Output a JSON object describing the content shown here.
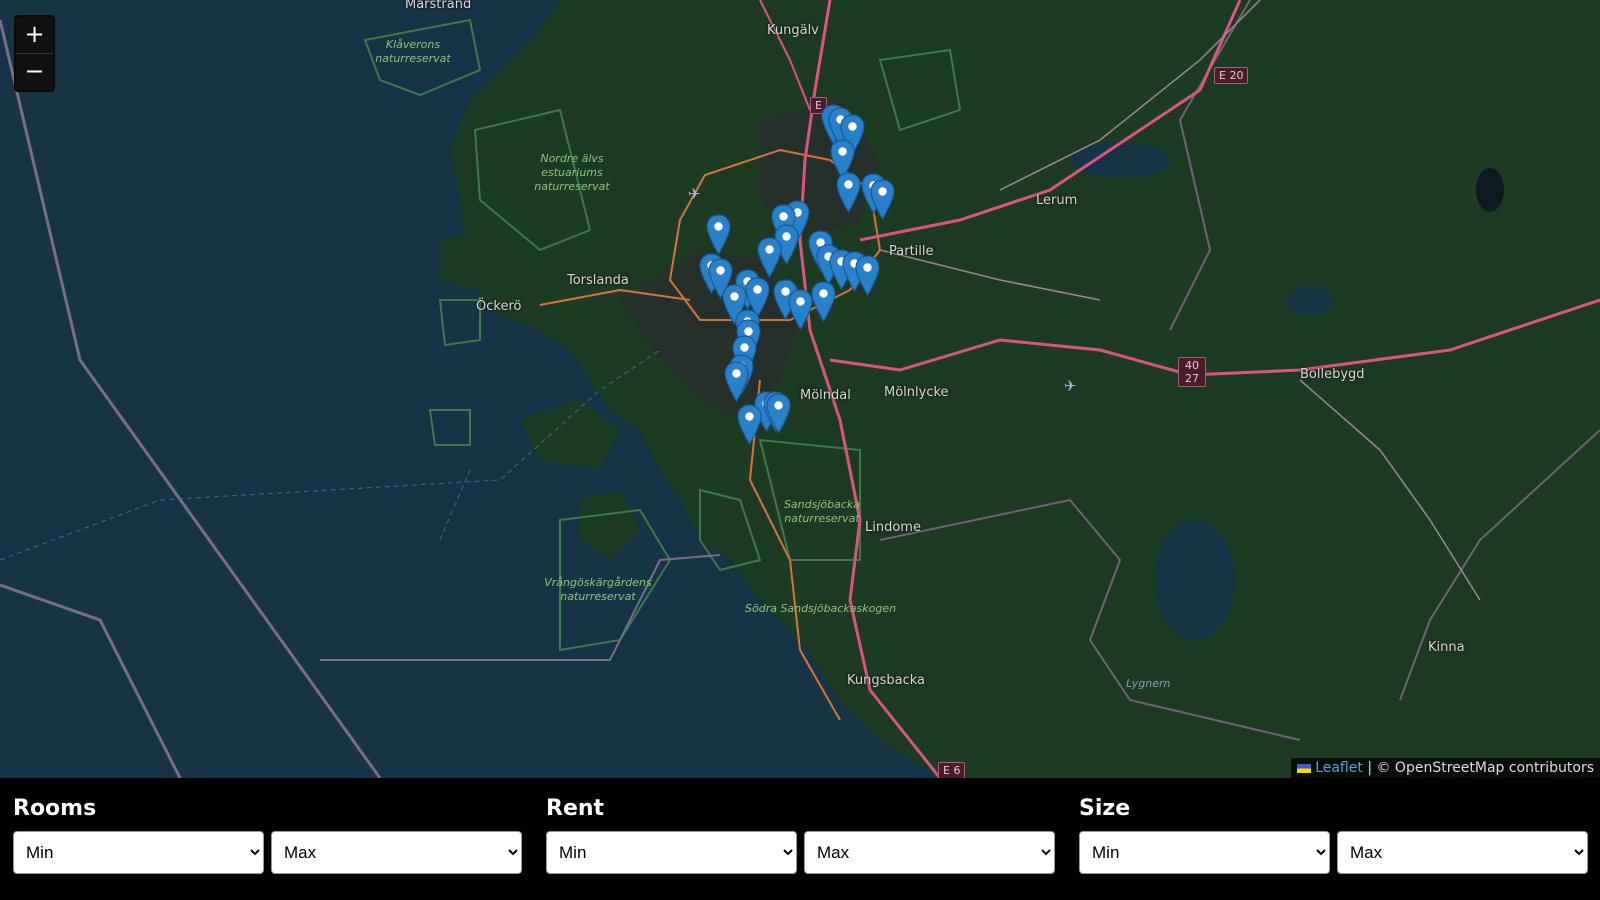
{
  "map": {
    "zoom_in": "+",
    "zoom_out": "−",
    "places": [
      "Marstrand",
      "Kungälv",
      "Lerum",
      "Torslanda",
      "Öckerö",
      "Partille",
      "Mölndal",
      "Mölnlycke",
      "Bollebygd",
      "Lindome",
      "Kungsbacka",
      "Kinna"
    ],
    "reserves": [
      "Klåverons naturreservat",
      "Nordre älvs estuariums naturreservat",
      "Sandsjöbacka naturreservat",
      "Vrångöskärgårdens naturreservat",
      "Södra Sandsjöbackaskogen",
      "Lygnern"
    ],
    "road_shields": [
      "E 20",
      "40 27",
      "E 6",
      "E"
    ],
    "marker_count": 34,
    "attribution_link": "Leaflet",
    "attribution_text": "| © OpenStreetMap contributors",
    "colors": {
      "water": "#173446",
      "land": "#1c3a22",
      "marker": "#2a81cb",
      "road": "#d9557f"
    }
  },
  "filters": [
    {
      "label": "Rooms",
      "min_placeholder": "Min",
      "max_placeholder": "Max"
    },
    {
      "label": "Rent",
      "min_placeholder": "Min",
      "max_placeholder": "Max"
    },
    {
      "label": "Size",
      "min_placeholder": "Min",
      "max_placeholder": "Max"
    }
  ]
}
